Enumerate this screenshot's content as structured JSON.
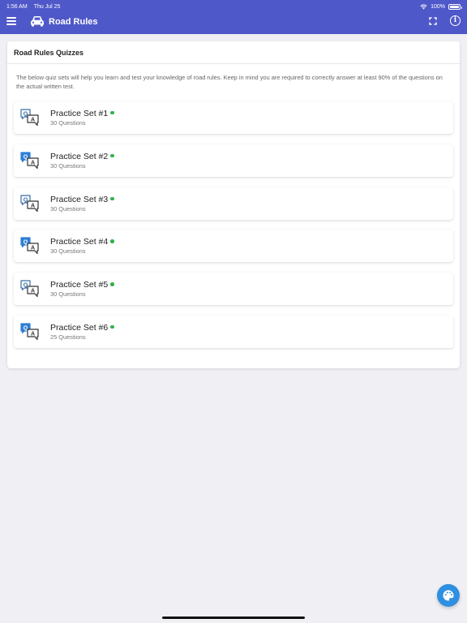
{
  "status_bar": {
    "time": "1:56 AM",
    "date": "Thu Jul 25",
    "battery": "100%"
  },
  "header": {
    "title": "Road Rules",
    "icons": [
      "menu-icon",
      "car-icon",
      "expand-icon",
      "info-icon"
    ],
    "color": "#4f58c9"
  },
  "card": {
    "title": "Road Rules Quizzes",
    "description": "The below quiz sets will help you learn and test your knowledge of road rules. Keep in mind you are required to correctly answer at least 90% of the questions on the actual written test."
  },
  "quizzes": [
    {
      "title": "Practice Set #1",
      "subtitle": "30 Questions",
      "icon": "qa-outline-icon"
    },
    {
      "title": "Practice Set #2",
      "subtitle": "30 Questions",
      "icon": "qa-filled-icon"
    },
    {
      "title": "Practice Set #3",
      "subtitle": "30 Questions",
      "icon": "qa-outline-icon"
    },
    {
      "title": "Practice Set #4",
      "subtitle": "30 Questions",
      "icon": "qa-filled-icon"
    },
    {
      "title": "Practice Set #5",
      "subtitle": "30 Questions",
      "icon": "qa-outline-icon"
    },
    {
      "title": "Practice Set #6",
      "subtitle": "25 Questions",
      "icon": "qa-filled-icon"
    }
  ],
  "status_dot_color": "#32b24a",
  "fab": {
    "icon": "palette-icon",
    "color": "#2f8fe0"
  }
}
